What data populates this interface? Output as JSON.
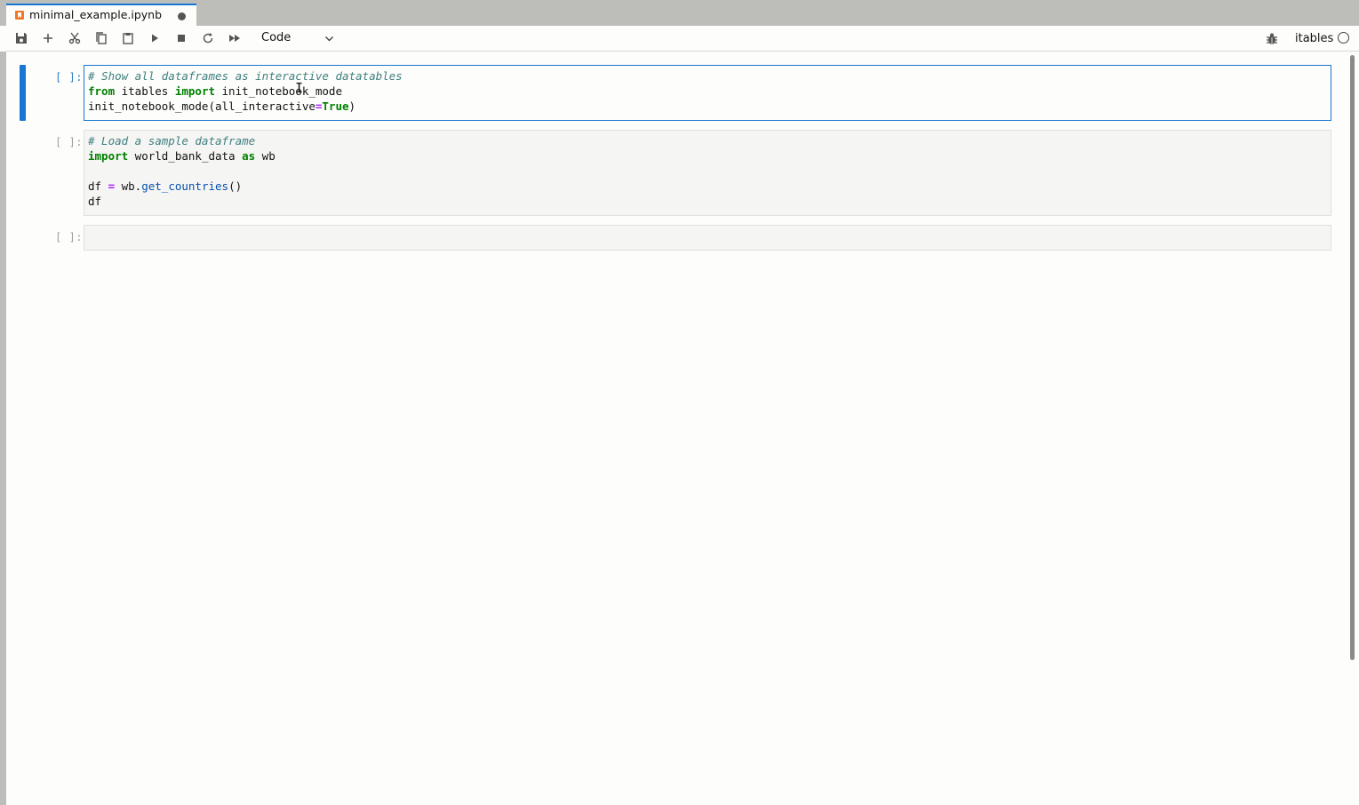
{
  "tab": {
    "title": "minimal_example.ipynb",
    "icon": "notebook-icon",
    "unsaved": true
  },
  "toolbar": {
    "buttons": [
      {
        "name": "save",
        "icon": "save-icon"
      },
      {
        "name": "insert-cell",
        "icon": "plus-icon"
      },
      {
        "name": "cut",
        "icon": "scissors-icon"
      },
      {
        "name": "copy",
        "icon": "copy-icon"
      },
      {
        "name": "paste",
        "icon": "paste-icon"
      },
      {
        "name": "run",
        "icon": "play-icon"
      },
      {
        "name": "interrupt",
        "icon": "stop-icon"
      },
      {
        "name": "restart",
        "icon": "restart-icon"
      },
      {
        "name": "restart-run-all",
        "icon": "fast-forward-icon"
      }
    ],
    "cell_type": "Code",
    "kernel_name": "itables",
    "kernel_status": "idle"
  },
  "cells": [
    {
      "prompt": "[ ]:",
      "active": true,
      "lines": [
        "# Show all dataframes as interactive datatables",
        "from itables import init_notebook_mode",
        "init_notebook_mode(all_interactive=True)"
      ]
    },
    {
      "prompt": "[ ]:",
      "active": false,
      "lines": [
        "# Load a sample dataframe",
        "import world_bank_data as wb",
        "",
        "df = wb.get_countries()",
        "df"
      ]
    },
    {
      "prompt": "[ ]:",
      "active": false,
      "lines": []
    }
  ],
  "colors": {
    "accent": "#1976d2",
    "comment": "#408080",
    "keyword": "#008000",
    "operator": "#aa22ff"
  }
}
